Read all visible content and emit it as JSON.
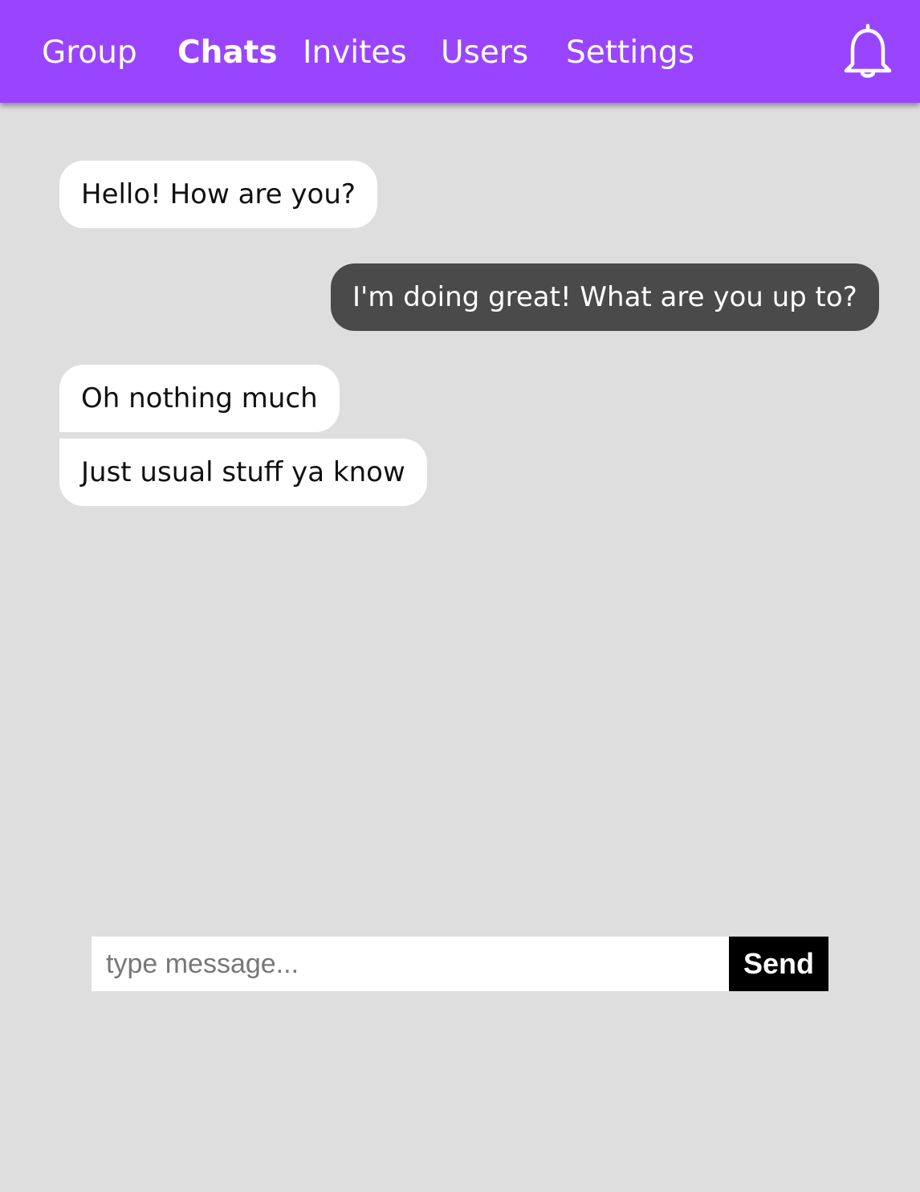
{
  "nav": {
    "items": [
      {
        "label": "Group",
        "active": false
      },
      {
        "label": "Chats",
        "active": true
      },
      {
        "label": "Invites",
        "active": false
      },
      {
        "label": "Users",
        "active": false
      },
      {
        "label": "Settings",
        "active": false
      }
    ],
    "notification_icon": "bell-icon",
    "background_color": "#9945ff"
  },
  "messages": [
    {
      "text": "Hello! How are you?",
      "direction": "incoming"
    },
    {
      "text": "I'm doing great! What are you up to?",
      "direction": "outgoing"
    },
    {
      "text": "Oh nothing much",
      "direction": "incoming"
    },
    {
      "text": "Just usual stuff ya know",
      "direction": "incoming"
    }
  ],
  "composer": {
    "placeholder": "type message...",
    "value": "",
    "send_label": "Send"
  }
}
